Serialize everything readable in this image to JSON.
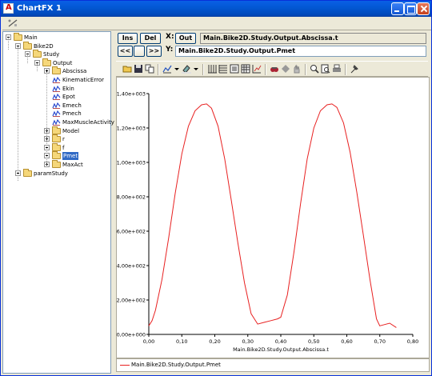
{
  "window": {
    "title": "ChartFX 1"
  },
  "tree": {
    "items": [
      {
        "label": "Main",
        "icon": "folder-icon"
      },
      {
        "label": "Bike2D",
        "icon": "folder-icon"
      },
      {
        "label": "Study",
        "icon": "folder-icon"
      },
      {
        "label": "Output",
        "icon": "folder-icon"
      },
      {
        "label": "Abscissa",
        "icon": "folder-icon"
      },
      {
        "label": "KinematicError",
        "icon": "signal-icon"
      },
      {
        "label": "Ekin",
        "icon": "signal-icon"
      },
      {
        "label": "Epot",
        "icon": "signal-icon"
      },
      {
        "label": "Emech",
        "icon": "signal-icon"
      },
      {
        "label": "Pmech",
        "icon": "signal-icon"
      },
      {
        "label": "MaxMuscleActivity",
        "icon": "signal-icon"
      },
      {
        "label": "Model",
        "icon": "folder-icon"
      },
      {
        "label": "r",
        "icon": "folder-icon"
      },
      {
        "label": "f",
        "icon": "folder-icon"
      },
      {
        "label": "Pmet",
        "icon": "folder-icon",
        "selected": true
      },
      {
        "label": "MaxAct",
        "icon": "folder-icon"
      },
      {
        "label": "paramStudy",
        "icon": "folder-icon"
      }
    ]
  },
  "controls": {
    "ins_label": "Ins",
    "del_label": "Del",
    "x_label": "X:",
    "out_label": "Out",
    "x_value": "Main.Bike2D.Study.Output.Abscissa.t",
    "prev_label": "<<",
    "next_label": ">>",
    "y_label": "Y:",
    "y_value": "Main.Bike2D.Study.Output.Pmet"
  },
  "legend": {
    "series_name": "Main.Bike2D.Study.Output.Pmet",
    "color": "#e82020"
  },
  "chart_data": {
    "type": "line",
    "xlabel": "Main.Bike2D.Study.Output.Abscissa.t",
    "ylabel": "",
    "xlim": [
      0,
      0.8
    ],
    "ylim": [
      0,
      1400
    ],
    "x_ticks": [
      "0,00",
      "0,10",
      "0,20",
      "0,30",
      "0,40",
      "0,50",
      "0,60",
      "0,70",
      "0,80"
    ],
    "y_ticks": [
      "0,00e+000",
      "2,00e+002",
      "4,00e+002",
      "6,00e+002",
      "8,00e+002",
      "1,00e+003",
      "1,20e+003",
      "1,40e+003"
    ],
    "grid": false,
    "series": [
      {
        "name": "Main.Bike2D.Study.Output.Pmet",
        "color": "#e82020",
        "x": [
          0.0,
          0.01,
          0.02,
          0.04,
          0.06,
          0.08,
          0.1,
          0.12,
          0.14,
          0.16,
          0.175,
          0.19,
          0.21,
          0.23,
          0.25,
          0.27,
          0.29,
          0.31,
          0.33,
          0.35,
          0.37,
          0.39,
          0.4,
          0.42,
          0.44,
          0.46,
          0.48,
          0.5,
          0.52,
          0.54,
          0.555,
          0.57,
          0.59,
          0.61,
          0.63,
          0.65,
          0.67,
          0.69,
          0.7,
          0.71,
          0.73,
          0.75
        ],
        "y": [
          50,
          80,
          140,
          320,
          560,
          820,
          1050,
          1210,
          1300,
          1335,
          1340,
          1315,
          1210,
          1020,
          780,
          530,
          300,
          120,
          60,
          70,
          80,
          90,
          100,
          230,
          480,
          760,
          1020,
          1200,
          1300,
          1335,
          1340,
          1320,
          1230,
          1060,
          830,
          580,
          320,
          90,
          50,
          55,
          65,
          40
        ]
      }
    ]
  }
}
